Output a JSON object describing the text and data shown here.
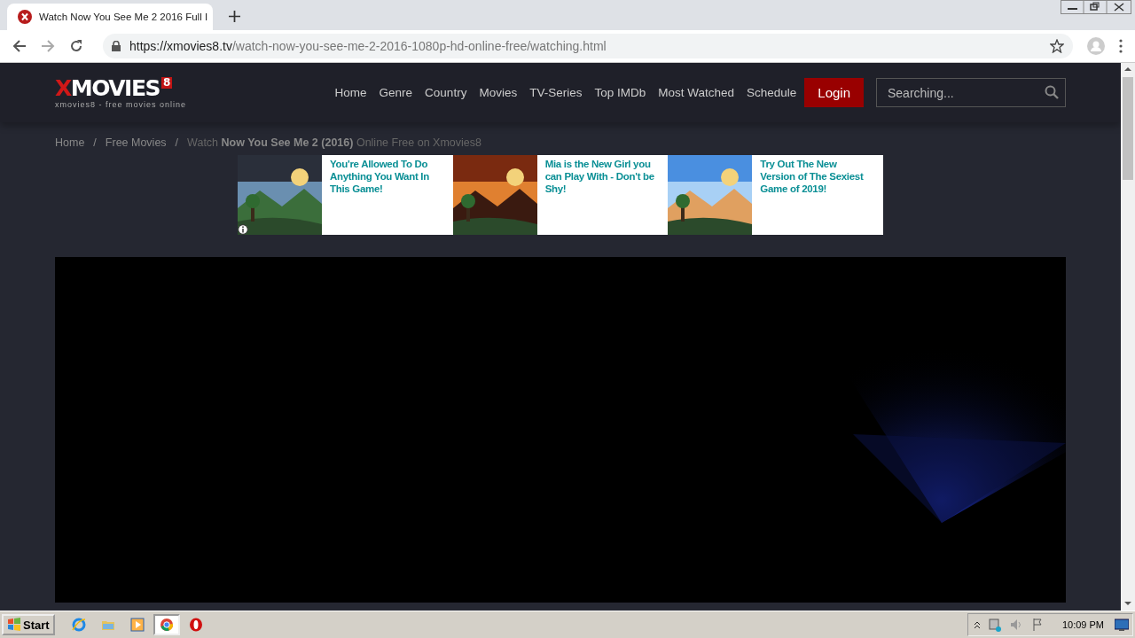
{
  "browser": {
    "tab": {
      "title": "Watch Now You See Me 2 2016 Full I"
    },
    "url": {
      "host": "https://xmovies8.tv",
      "path": "/watch-now-you-see-me-2-2016-1080p-hd-online-free/watching.html"
    }
  },
  "site": {
    "logo": {
      "mark": "X",
      "name": "MOVIES",
      "badge": "8",
      "tagline": "xmovies8 - free movies online"
    },
    "nav": [
      "Home",
      "Genre",
      "Country",
      "Movies",
      "TV-Series",
      "Top IMDb",
      "Most Watched",
      "Schedule"
    ],
    "login": "Login",
    "search": {
      "placeholder": "Searching..."
    },
    "breadcrumb": [
      {
        "kind": "link",
        "text": "Home"
      },
      {
        "kind": "separator",
        "text": "/"
      },
      {
        "kind": "link",
        "text": "Free Movies"
      },
      {
        "kind": "separator",
        "text": "/"
      },
      {
        "kind": "current",
        "text": "Watch **Now You See Me 2 (2016)** Online Free on Xmovies8"
      }
    ],
    "ads": [
      {
        "text": "You're Allowed To Do Anything You Want In This Game!"
      },
      {
        "text": "Mia is the New Girl you can Play With - Don't be Shy!"
      },
      {
        "text": "Try Out The New Version of The Sexiest Game of 2019!"
      }
    ]
  },
  "taskbar": {
    "start": "Start",
    "apps": [
      {
        "kind": "ie",
        "selected": false
      },
      {
        "kind": "folder",
        "selected": false
      },
      {
        "kind": "media",
        "selected": false
      },
      {
        "kind": "chrome",
        "selected": true
      },
      {
        "kind": "opera",
        "selected": false
      }
    ],
    "clock": "10:09 PM"
  }
}
